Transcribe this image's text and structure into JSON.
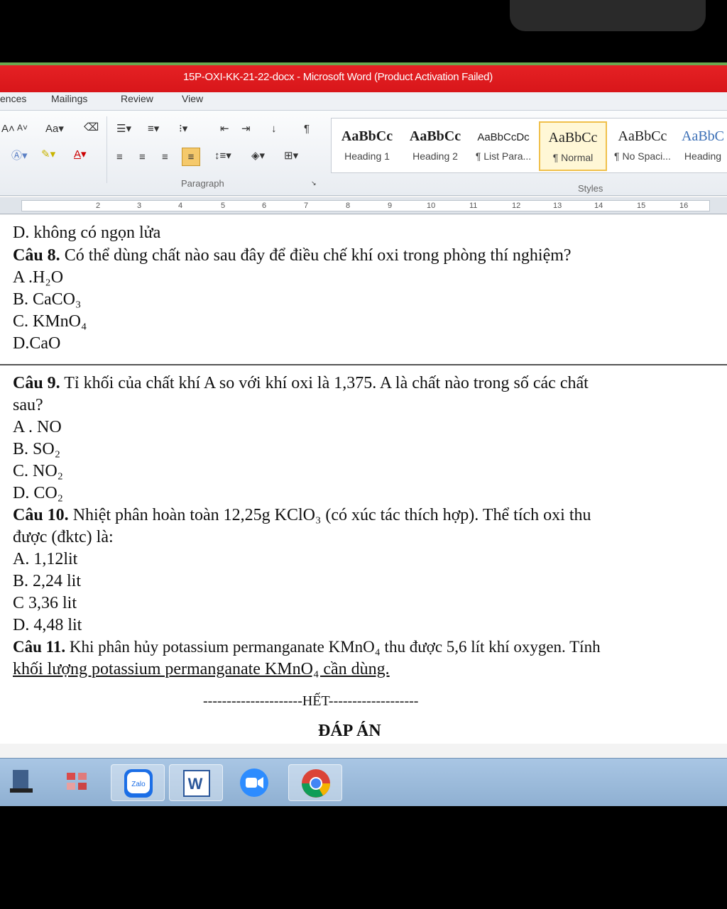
{
  "window": {
    "title": "15P-OXI-KK-21-22-docx - Microsoft Word (Product Activation Failed)"
  },
  "ribbon_tabs": [
    "ences",
    "Mailings",
    "Review",
    "View"
  ],
  "ribbon": {
    "paragraph_label": "Paragraph",
    "styles_label": "Styles",
    "styles": [
      {
        "sample": "AaBbCc",
        "name": "Heading 1"
      },
      {
        "sample": "AaBbCc",
        "name": "Heading 2"
      },
      {
        "sample": "AaBbCcDc",
        "name": "¶ List Para..."
      },
      {
        "sample": "AaBbCc",
        "name": "¶ Normal"
      },
      {
        "sample": "AaBbCc",
        "name": "¶ No Spaci..."
      },
      {
        "sample": "AaBbC",
        "name": "Heading"
      }
    ]
  },
  "ruler": {
    "numbers": [
      "2",
      "3",
      "4",
      "5",
      "6",
      "7",
      "8",
      "9",
      "10",
      "11",
      "12",
      "13",
      "14",
      "15",
      "16"
    ]
  },
  "document": {
    "l01": "D. không có ngọn lửa",
    "q8_label": "Câu 8.",
    "q8_text": " Có thể dùng chất nào sau đây để điều chế khí oxi trong phòng thí nghiệm?",
    "q8_a": "A .H₂O",
    "q8_b": "B. CaCO₃",
    "q8_c": "C. KMnO₄",
    "q8_d": "D.CaO",
    "q9_label": "Câu 9.",
    "q9_text": " Tỉ khối của chất khí A so với khí oxi là 1,375. A là chất nào trong số các chất",
    "q9_text2": "sau?",
    "q9_a": "A . NO",
    "q9_b": "B. SO₂",
    "q9_c": "C. NO₂",
    "q9_d": "D. CO₂",
    "q10_label": "Câu 10.",
    "q10_text": " Nhiệt phân hoàn toàn 12,25g KClO₃ (có xúc tác thích hợp). Thể tích oxi thu",
    "q10_text2": "được (đktc) là:",
    "q10_a": "A. 1,12lit",
    "q10_b": "B. 2,24 lit",
    "q10_c": "C 3,36 lit",
    "q10_d": "D. 4,48 lit",
    "q11_label": "Câu 11.",
    "q11_text": " Khi phân hủy potassium permanganate KMnO₄ thu được 5,6 lít khí oxygen. Tính",
    "q11_text2": "khối lượng potassium permanganate KMnO₄ cần dùng.",
    "end": "---------------------HẾT-------------------",
    "answer_title": "ĐÁP ÁN"
  },
  "taskbar": {
    "apps": [
      "file-explorer",
      "calculator",
      "zalo",
      "word",
      "zoom",
      "chrome"
    ],
    "zalo_label": "Zalo",
    "word_label": "W"
  }
}
